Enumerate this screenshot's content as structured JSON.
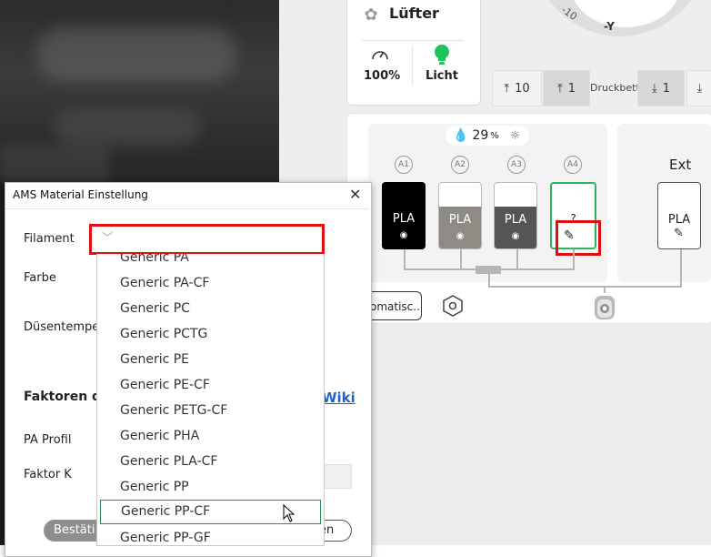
{
  "fan": {
    "title": "Lüfter",
    "speed": "100%",
    "light": "Licht"
  },
  "compass": {
    "tick": "-10",
    "axis": "-Y"
  },
  "move_buttons": [
    {
      "icon": "arrow-up-icon",
      "label": "10"
    },
    {
      "icon": "arrow-up-icon",
      "label": "1"
    },
    {
      "icon": "arrow-down-icon",
      "label": "1"
    }
  ],
  "druckbett_label": "Druckbett",
  "ams": {
    "humidity_value": "29",
    "humidity_unit": "%",
    "slots": [
      {
        "id": "A1",
        "material": "PLA",
        "color": "#000000"
      },
      {
        "id": "A2",
        "material": "PLA",
        "color": "#8d8b84"
      },
      {
        "id": "A3",
        "material": "PLA",
        "color": "#555555"
      },
      {
        "id": "A4",
        "material": "?",
        "color": "#ffffff"
      }
    ],
    "ext_label": "Ext",
    "ext_material": "PLA",
    "auto_button": "omatisc..."
  },
  "dialog": {
    "title": "AMS Material Einstellung",
    "filament_label": "Filament",
    "farbe_label": "Farbe",
    "duesen_label": "Düsentemper",
    "faktoren_label": "Faktoren de",
    "wiki_link": "Wiki",
    "pa_profil_label": "PA Profil",
    "faktor_k_label": "Faktor K",
    "confirm_button": "Bestäti",
    "cancel_button": "en"
  },
  "dropdown": {
    "items": [
      "Generic PA",
      "Generic PA-CF",
      "Generic PC",
      "Generic PCTG",
      "Generic PE",
      "Generic PE-CF",
      "Generic PETG-CF",
      "Generic PHA",
      "Generic PLA-CF",
      "Generic PP",
      "Generic PP-CF",
      "Generic PP-GF"
    ],
    "hovered_index": 10
  },
  "colors": {
    "accent_green": "#2e8b57",
    "highlight_red": "#e01010",
    "link_blue": "#1e63c7"
  }
}
